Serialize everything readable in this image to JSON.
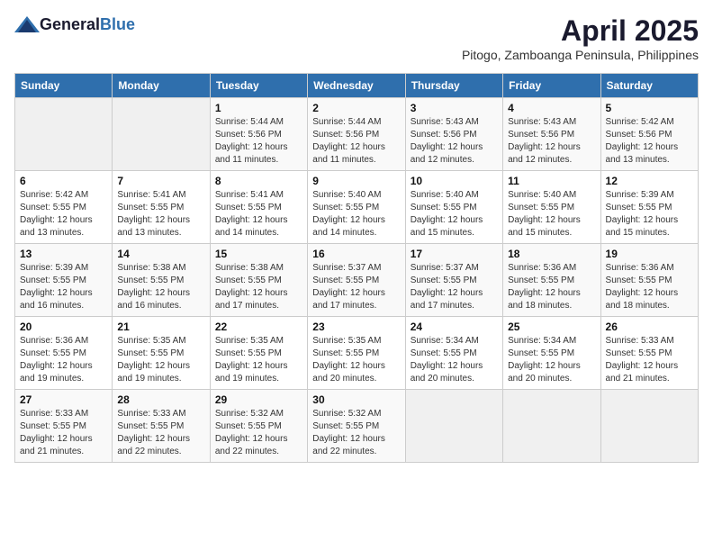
{
  "header": {
    "logo_general": "General",
    "logo_blue": "Blue",
    "title": "April 2025",
    "subtitle": "Pitogo, Zamboanga Peninsula, Philippines"
  },
  "calendar": {
    "columns": [
      "Sunday",
      "Monday",
      "Tuesday",
      "Wednesday",
      "Thursday",
      "Friday",
      "Saturday"
    ],
    "weeks": [
      [
        {
          "day": "",
          "info": ""
        },
        {
          "day": "",
          "info": ""
        },
        {
          "day": "1",
          "info": "Sunrise: 5:44 AM\nSunset: 5:56 PM\nDaylight: 12 hours\nand 11 minutes."
        },
        {
          "day": "2",
          "info": "Sunrise: 5:44 AM\nSunset: 5:56 PM\nDaylight: 12 hours\nand 11 minutes."
        },
        {
          "day": "3",
          "info": "Sunrise: 5:43 AM\nSunset: 5:56 PM\nDaylight: 12 hours\nand 12 minutes."
        },
        {
          "day": "4",
          "info": "Sunrise: 5:43 AM\nSunset: 5:56 PM\nDaylight: 12 hours\nand 12 minutes."
        },
        {
          "day": "5",
          "info": "Sunrise: 5:42 AM\nSunset: 5:56 PM\nDaylight: 12 hours\nand 13 minutes."
        }
      ],
      [
        {
          "day": "6",
          "info": "Sunrise: 5:42 AM\nSunset: 5:55 PM\nDaylight: 12 hours\nand 13 minutes."
        },
        {
          "day": "7",
          "info": "Sunrise: 5:41 AM\nSunset: 5:55 PM\nDaylight: 12 hours\nand 13 minutes."
        },
        {
          "day": "8",
          "info": "Sunrise: 5:41 AM\nSunset: 5:55 PM\nDaylight: 12 hours\nand 14 minutes."
        },
        {
          "day": "9",
          "info": "Sunrise: 5:40 AM\nSunset: 5:55 PM\nDaylight: 12 hours\nand 14 minutes."
        },
        {
          "day": "10",
          "info": "Sunrise: 5:40 AM\nSunset: 5:55 PM\nDaylight: 12 hours\nand 15 minutes."
        },
        {
          "day": "11",
          "info": "Sunrise: 5:40 AM\nSunset: 5:55 PM\nDaylight: 12 hours\nand 15 minutes."
        },
        {
          "day": "12",
          "info": "Sunrise: 5:39 AM\nSunset: 5:55 PM\nDaylight: 12 hours\nand 15 minutes."
        }
      ],
      [
        {
          "day": "13",
          "info": "Sunrise: 5:39 AM\nSunset: 5:55 PM\nDaylight: 12 hours\nand 16 minutes."
        },
        {
          "day": "14",
          "info": "Sunrise: 5:38 AM\nSunset: 5:55 PM\nDaylight: 12 hours\nand 16 minutes."
        },
        {
          "day": "15",
          "info": "Sunrise: 5:38 AM\nSunset: 5:55 PM\nDaylight: 12 hours\nand 17 minutes."
        },
        {
          "day": "16",
          "info": "Sunrise: 5:37 AM\nSunset: 5:55 PM\nDaylight: 12 hours\nand 17 minutes."
        },
        {
          "day": "17",
          "info": "Sunrise: 5:37 AM\nSunset: 5:55 PM\nDaylight: 12 hours\nand 17 minutes."
        },
        {
          "day": "18",
          "info": "Sunrise: 5:36 AM\nSunset: 5:55 PM\nDaylight: 12 hours\nand 18 minutes."
        },
        {
          "day": "19",
          "info": "Sunrise: 5:36 AM\nSunset: 5:55 PM\nDaylight: 12 hours\nand 18 minutes."
        }
      ],
      [
        {
          "day": "20",
          "info": "Sunrise: 5:36 AM\nSunset: 5:55 PM\nDaylight: 12 hours\nand 19 minutes."
        },
        {
          "day": "21",
          "info": "Sunrise: 5:35 AM\nSunset: 5:55 PM\nDaylight: 12 hours\nand 19 minutes."
        },
        {
          "day": "22",
          "info": "Sunrise: 5:35 AM\nSunset: 5:55 PM\nDaylight: 12 hours\nand 19 minutes."
        },
        {
          "day": "23",
          "info": "Sunrise: 5:35 AM\nSunset: 5:55 PM\nDaylight: 12 hours\nand 20 minutes."
        },
        {
          "day": "24",
          "info": "Sunrise: 5:34 AM\nSunset: 5:55 PM\nDaylight: 12 hours\nand 20 minutes."
        },
        {
          "day": "25",
          "info": "Sunrise: 5:34 AM\nSunset: 5:55 PM\nDaylight: 12 hours\nand 20 minutes."
        },
        {
          "day": "26",
          "info": "Sunrise: 5:33 AM\nSunset: 5:55 PM\nDaylight: 12 hours\nand 21 minutes."
        }
      ],
      [
        {
          "day": "27",
          "info": "Sunrise: 5:33 AM\nSunset: 5:55 PM\nDaylight: 12 hours\nand 21 minutes."
        },
        {
          "day": "28",
          "info": "Sunrise: 5:33 AM\nSunset: 5:55 PM\nDaylight: 12 hours\nand 22 minutes."
        },
        {
          "day": "29",
          "info": "Sunrise: 5:32 AM\nSunset: 5:55 PM\nDaylight: 12 hours\nand 22 minutes."
        },
        {
          "day": "30",
          "info": "Sunrise: 5:32 AM\nSunset: 5:55 PM\nDaylight: 12 hours\nand 22 minutes."
        },
        {
          "day": "",
          "info": ""
        },
        {
          "day": "",
          "info": ""
        },
        {
          "day": "",
          "info": ""
        }
      ]
    ]
  }
}
